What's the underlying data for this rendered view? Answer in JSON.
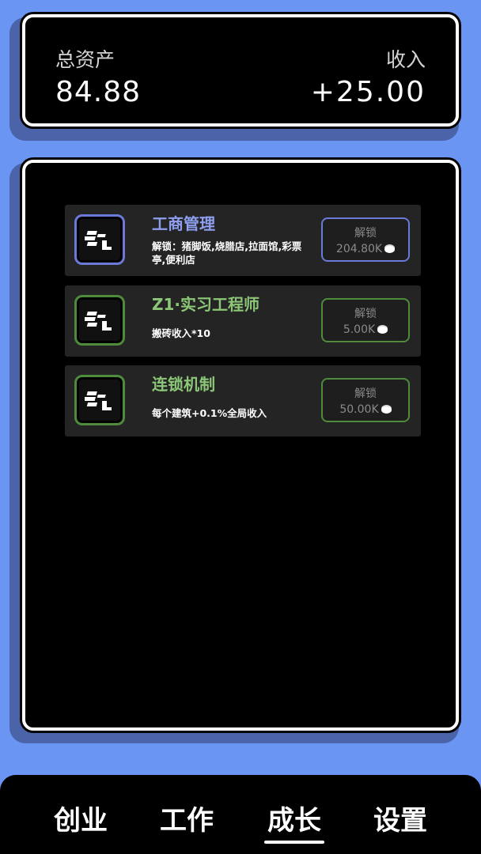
{
  "assets": {
    "total_label": "总资产",
    "total_value": "84.88",
    "income_label": "收入",
    "income_value": "+25.00"
  },
  "growth_items": [
    {
      "title": "工商管理",
      "title_color": "#8f9ff0",
      "desc": "解锁：猪脚饭,烧腊店,拉面馆,彩票亭,便利店",
      "unlock_label": "解锁",
      "cost": "204.80K",
      "accent": "#6b7ad9",
      "icon": "bricks-icon"
    },
    {
      "title": "Z1·实习工程师",
      "title_color": "#8bc776",
      "desc": "搬砖收入*10",
      "unlock_label": "解锁",
      "cost": "5.00K",
      "accent": "#4f8b3c",
      "icon": "bricks-icon"
    },
    {
      "title": "连锁机制",
      "title_color": "#8bc776",
      "desc": "每个建筑+0.1%全局收入",
      "unlock_label": "解锁",
      "cost": "50.00K",
      "accent": "#4f8b3c",
      "icon": "bricks-icon"
    }
  ],
  "nav": {
    "items": [
      "创业",
      "工作",
      "成长",
      "设置"
    ],
    "active": "成长"
  }
}
